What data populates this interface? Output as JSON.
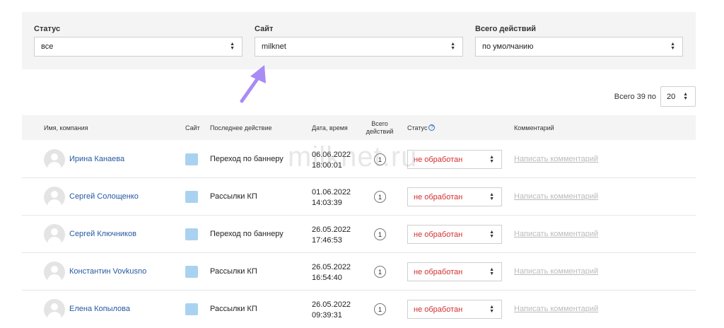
{
  "filters": [
    {
      "label": "Статус",
      "value": "все"
    },
    {
      "label": "Сайт",
      "value": "milknet"
    },
    {
      "label": "Всего действий",
      "value": "по умолчанию"
    }
  ],
  "pager": {
    "label": "Всего 39 по",
    "value": "20"
  },
  "table": {
    "headers": {
      "name": "Имя, компания",
      "site": "Сайт",
      "last_action": "Последнее действие",
      "datetime": "Дата, время",
      "total": "Всего действий",
      "status": "Статус",
      "comment": "Комментарий"
    },
    "rows": [
      {
        "name": "Ирина Канаева",
        "action": "Переход по баннеру",
        "date": "06.06.2022",
        "time": "18:00:01",
        "count": "1",
        "status": "не обработан",
        "comment": "Написать комментарий"
      },
      {
        "name": "Сергей Солощенко",
        "action": "Рассылки КП",
        "date": "01.06.2022",
        "time": "14:03:39",
        "count": "1",
        "status": "не обработан",
        "comment": "Написать комментарий"
      },
      {
        "name": "Сергей Ключников",
        "action": "Переход по баннеру",
        "date": "26.05.2022",
        "time": "17:46:53",
        "count": "1",
        "status": "не обработан",
        "comment": "Написать комментарий"
      },
      {
        "name": "Константин Vovkusno",
        "action": "Рассылки КП",
        "date": "26.05.2022",
        "time": "16:54:40",
        "count": "1",
        "status": "не обработан",
        "comment": "Написать комментарий"
      },
      {
        "name": "Елена Копылова",
        "action": "Рассылки КП",
        "date": "26.05.2022",
        "time": "09:39:31",
        "count": "1",
        "status": "не обработан",
        "comment": "Написать комментарий"
      }
    ]
  },
  "watermark": "milknet.ru",
  "colors": {
    "accent_link": "#2658a0",
    "status_red": "#d32f2f",
    "annotation_arrow": "#a98bf5"
  }
}
